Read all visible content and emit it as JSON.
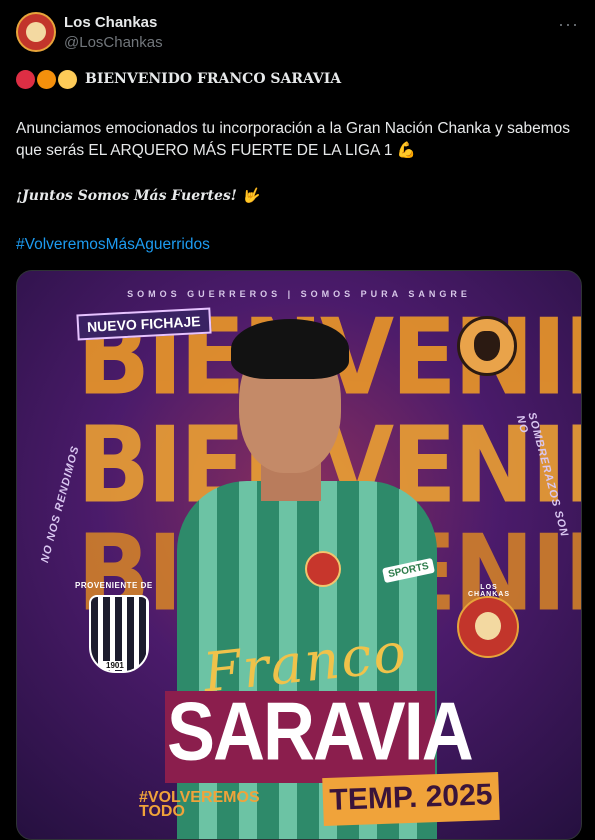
{
  "post": {
    "author_name": "Los Chankas",
    "handle": "@LosChankas",
    "more_icon": "···",
    "title": "BIENVENIDO FRANCO SARAVIA",
    "body": "Anunciamos emocionados tu incorporación a la Gran Nación Chanka y sabemos que serás EL ARQUERO MÁS FUERTE DE LA LIGA 1 💪",
    "slogan": "¡Juntos Somos Más Fuertes! 🤟",
    "hashtag": "#VolveremosMásAguerridos"
  },
  "graphic": {
    "banner_top": "SOMOS GUERREROS | SOMOS PURA SANGRE",
    "big_word_1": "BIENVENIDO",
    "big_word_2": "BIENVENIDO",
    "big_word_3": "BIENVENIDO",
    "nuevo_fichaje": "NUEVO FICHAJE",
    "side_left": "NO NOS RENDIMOS",
    "side_right": "SOMBRERAZOS SON NO",
    "proveniente": "PROVENIENTE DE",
    "alianza_year": "1901",
    "club_right": "LOS CHANKAS",
    "sponsor": "SPORTS",
    "first_name": "Franco",
    "surname": "SARAVIA",
    "volveremos_1": "#VOLVEREMOS",
    "volveremos_2": "TODO",
    "season": "TEMP. 2025"
  },
  "colors": {
    "link": "#1d9bf0",
    "accent_orange": "#e8952a",
    "purple_bg": "#4b1b6b",
    "surname_box": "#8b1e4d"
  }
}
